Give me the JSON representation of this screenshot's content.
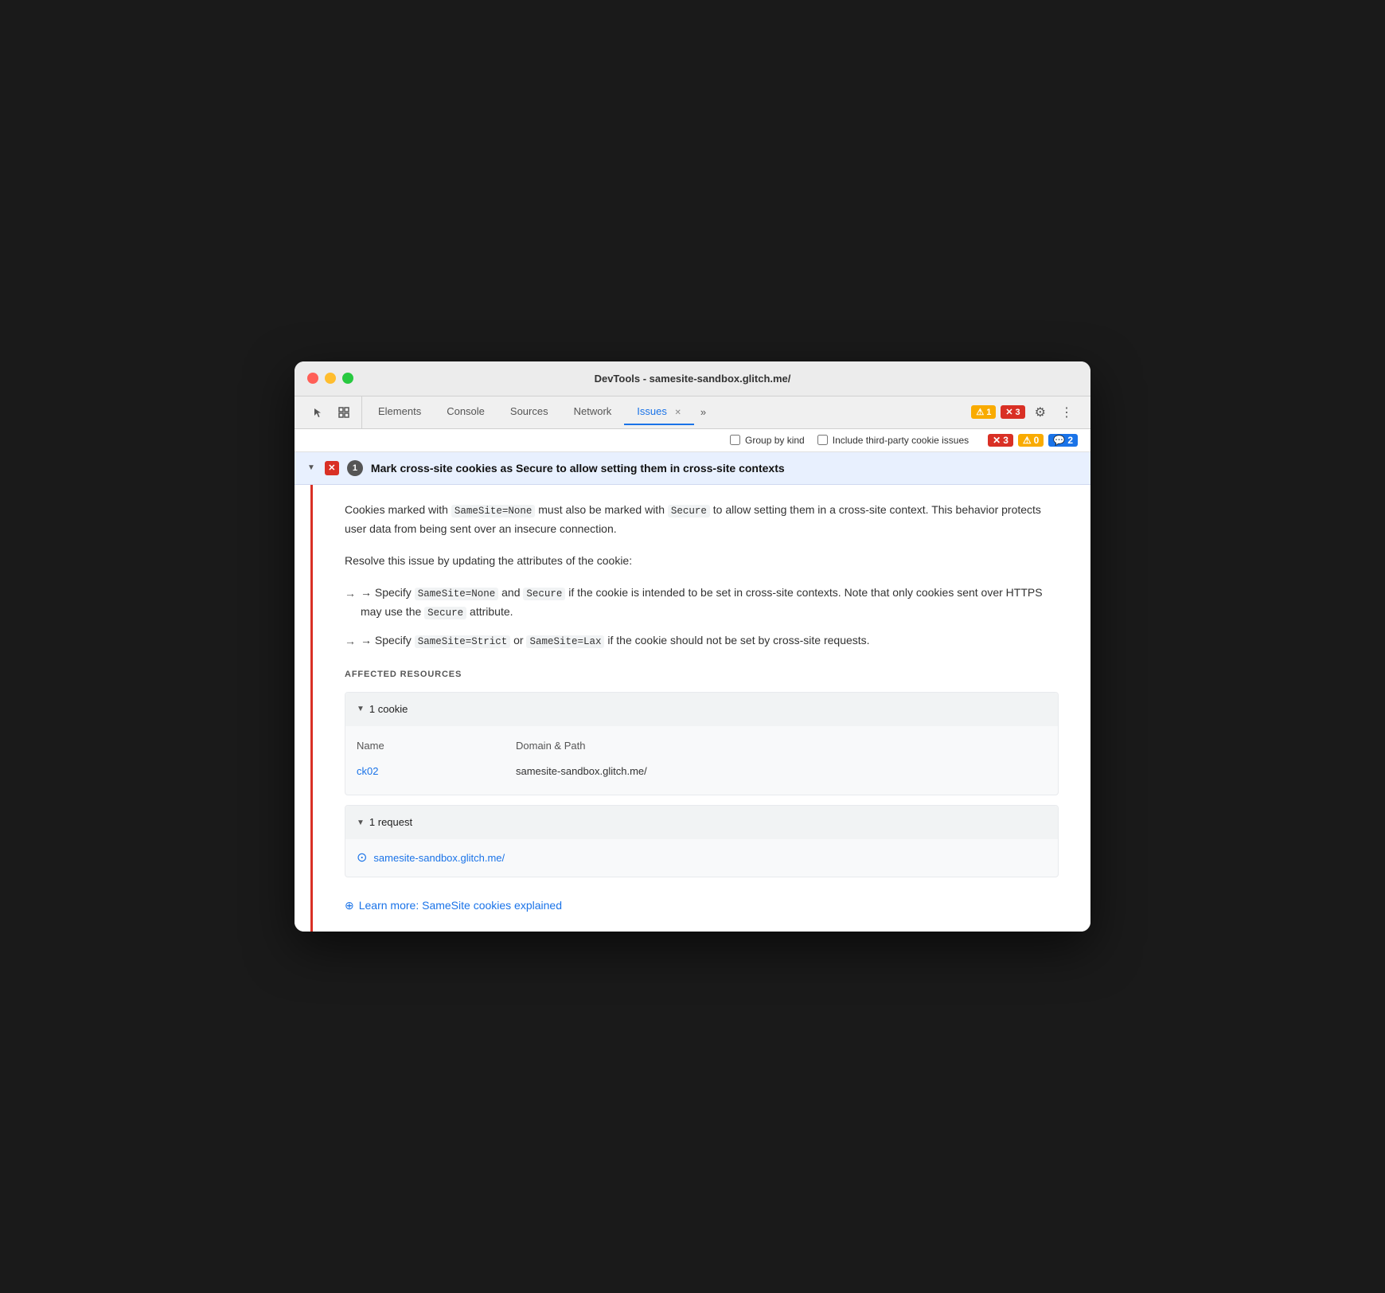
{
  "window": {
    "title": "DevTools - samesite-sandbox.glitch.me/"
  },
  "toolbar": {
    "tabs": [
      {
        "id": "elements",
        "label": "Elements",
        "active": false
      },
      {
        "id": "console",
        "label": "Console",
        "active": false
      },
      {
        "id": "sources",
        "label": "Sources",
        "active": false
      },
      {
        "id": "network",
        "label": "Network",
        "active": false
      },
      {
        "id": "issues",
        "label": "Issues",
        "active": true,
        "closeable": true
      }
    ],
    "more_tabs_label": "»",
    "warning_badge": {
      "icon": "⚠",
      "count": "1"
    },
    "error_badge": {
      "icon": "✕",
      "count": "3"
    }
  },
  "filter_bar": {
    "group_by_kind_label": "Group by kind",
    "third_party_label": "Include third-party cookie issues",
    "counts": {
      "error": {
        "icon": "✕",
        "value": "3"
      },
      "warning": {
        "icon": "⚠",
        "value": "0"
      },
      "info": {
        "icon": "💬",
        "value": "2"
      }
    }
  },
  "issue": {
    "expand_arrow": "▼",
    "error_icon": "✕",
    "count": "1",
    "title": "Mark cross-site cookies as Secure to allow setting them in cross-site contexts",
    "description1": "Cookies marked with ",
    "code1": "SameSite=None",
    "description1b": " must also be marked with ",
    "code2": "Secure",
    "description1c": " to allow setting them in a cross-site context. This behavior protects user data from being sent over an insecure connection.",
    "resolve_text": "Resolve this issue by updating the attributes of the cookie:",
    "bullet1_prefix": "→ Specify ",
    "bullet1_code1": "SameSite=None",
    "bullet1_and": " and ",
    "bullet1_code2": "Secure",
    "bullet1_suffix": " if the cookie is intended to be set in cross-site contexts. Note that only cookies sent over HTTPS may use the ",
    "bullet1_code3": "Secure",
    "bullet1_end": " attribute.",
    "bullet2_prefix": "→ Specify ",
    "bullet2_code1": "SameSite=Strict",
    "bullet2_or": " or ",
    "bullet2_code2": "SameSite=Lax",
    "bullet2_suffix": " if the cookie should not be set by cross-site requests.",
    "affected_resources_label": "AFFECTED RESOURCES",
    "cookie_section": {
      "expand_arrow": "▼",
      "count_label": "1 cookie",
      "col_name": "Name",
      "col_domain_path": "Domain & Path",
      "cookie_name": "ck02",
      "cookie_domain": "samesite-sandbox.glitch.me/"
    },
    "request_section": {
      "expand_arrow": "▼",
      "count_label": "1 request",
      "request_icon": "⊙",
      "request_url": "samesite-sandbox.glitch.me/"
    },
    "learn_more": {
      "icon": "⊕",
      "text": "Learn more: SameSite cookies explained",
      "href": "#"
    }
  }
}
